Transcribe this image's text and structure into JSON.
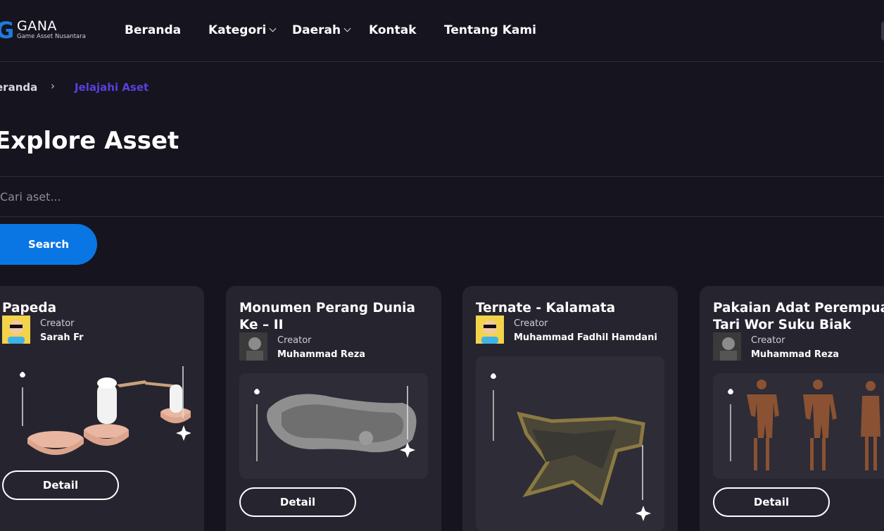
{
  "header": {
    "logo_letter": "G",
    "logo_name": "GANA",
    "logo_tagline": "Game Asset Nusantara",
    "nav": [
      {
        "label": "Beranda"
      },
      {
        "label": "Kategori"
      },
      {
        "label": "Daerah"
      },
      {
        "label": "Kontak"
      },
      {
        "label": "Tentang Kami"
      }
    ]
  },
  "breadcrumb": {
    "home": "eranda",
    "separator": "›",
    "current": "Jelajahi Aset"
  },
  "page_title": "Explore Asset",
  "search": {
    "placeholder": "Cari aset...",
    "value": "",
    "button_label": "Search"
  },
  "cards": [
    {
      "title": "Papeda",
      "creator_label": "Creator",
      "creator_name": "Sarah Fr",
      "button_label": "Detail"
    },
    {
      "title": "Monumen Perang Dunia Ke – II",
      "creator_label": "Creator",
      "creator_name": "Muhammad Reza",
      "button_label": "Detail"
    },
    {
      "title": "Ternate - Kalamata",
      "creator_label": "Creator",
      "creator_name": "Muhammad Fadhil Hamdani",
      "button_label": "Detail"
    },
    {
      "title": "Pakaian Adat Perempuan Tari Wor Suku Biak",
      "creator_label": "Creator",
      "creator_name": "Muhammad Reza",
      "button_label": "Detail"
    }
  ],
  "colors": {
    "background": "#16141f",
    "card": "#26242f",
    "accent_blue": "#0a76e4",
    "breadcrumb_active": "#5a3fe0"
  }
}
